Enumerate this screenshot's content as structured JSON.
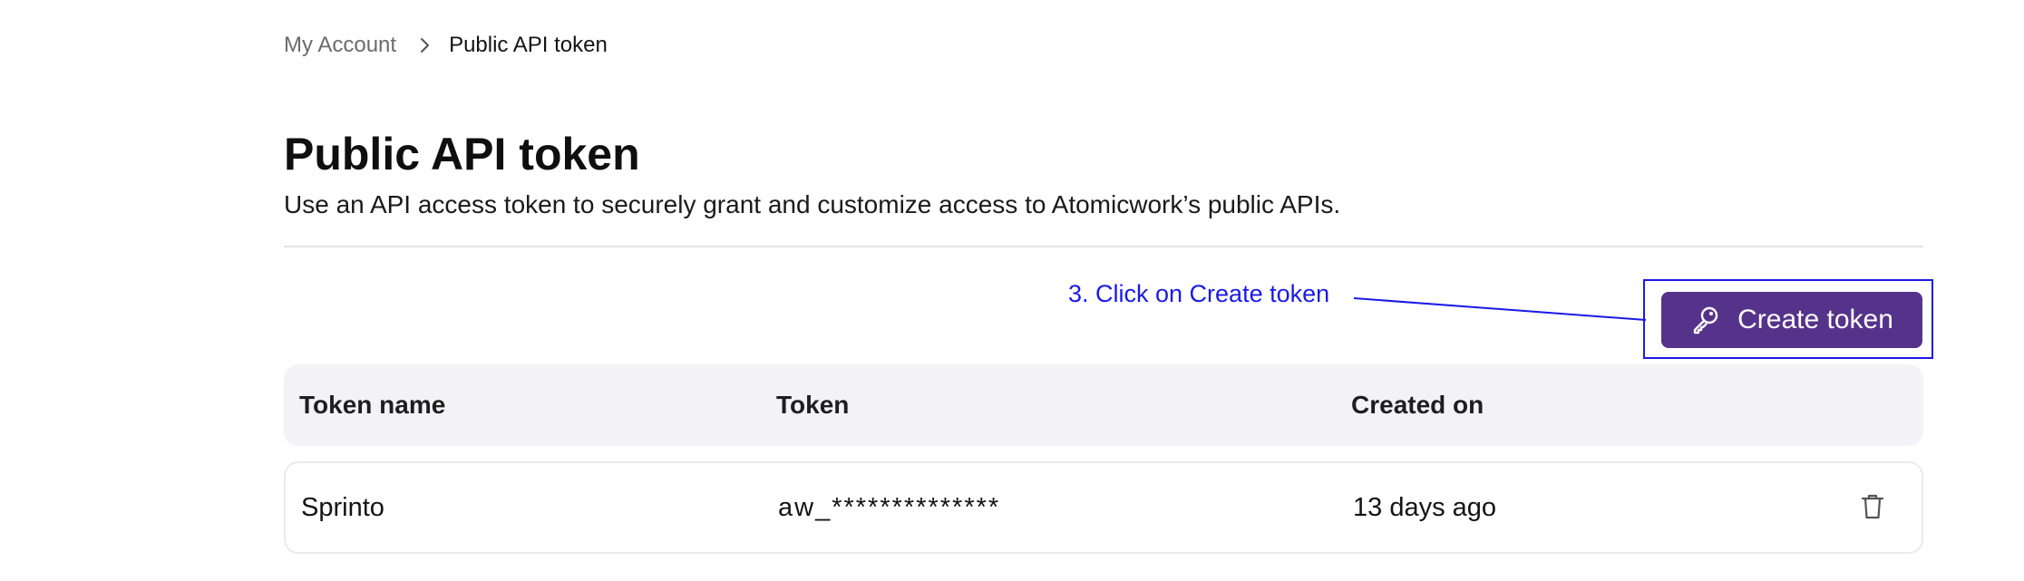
{
  "breadcrumb": {
    "parent": "My Account",
    "current": "Public API token",
    "separator_icon": "chevron-right-icon"
  },
  "page": {
    "title": "Public API token",
    "subtitle": "Use an API access token to securely grant and customize access to Atomicwork’s public APIs."
  },
  "annotation": {
    "text": "3. Click on Create token",
    "color": "#1a1ae6"
  },
  "actions": {
    "create_token_label": "Create token",
    "create_token_icon": "key-icon",
    "button_color": "#56338a"
  },
  "table": {
    "columns": [
      "Token name",
      "Token",
      "Created on"
    ],
    "rows": [
      {
        "name": "Sprinto",
        "token": "aw_**************",
        "created_on": "13 days ago",
        "delete_icon": "trash-icon"
      }
    ]
  }
}
